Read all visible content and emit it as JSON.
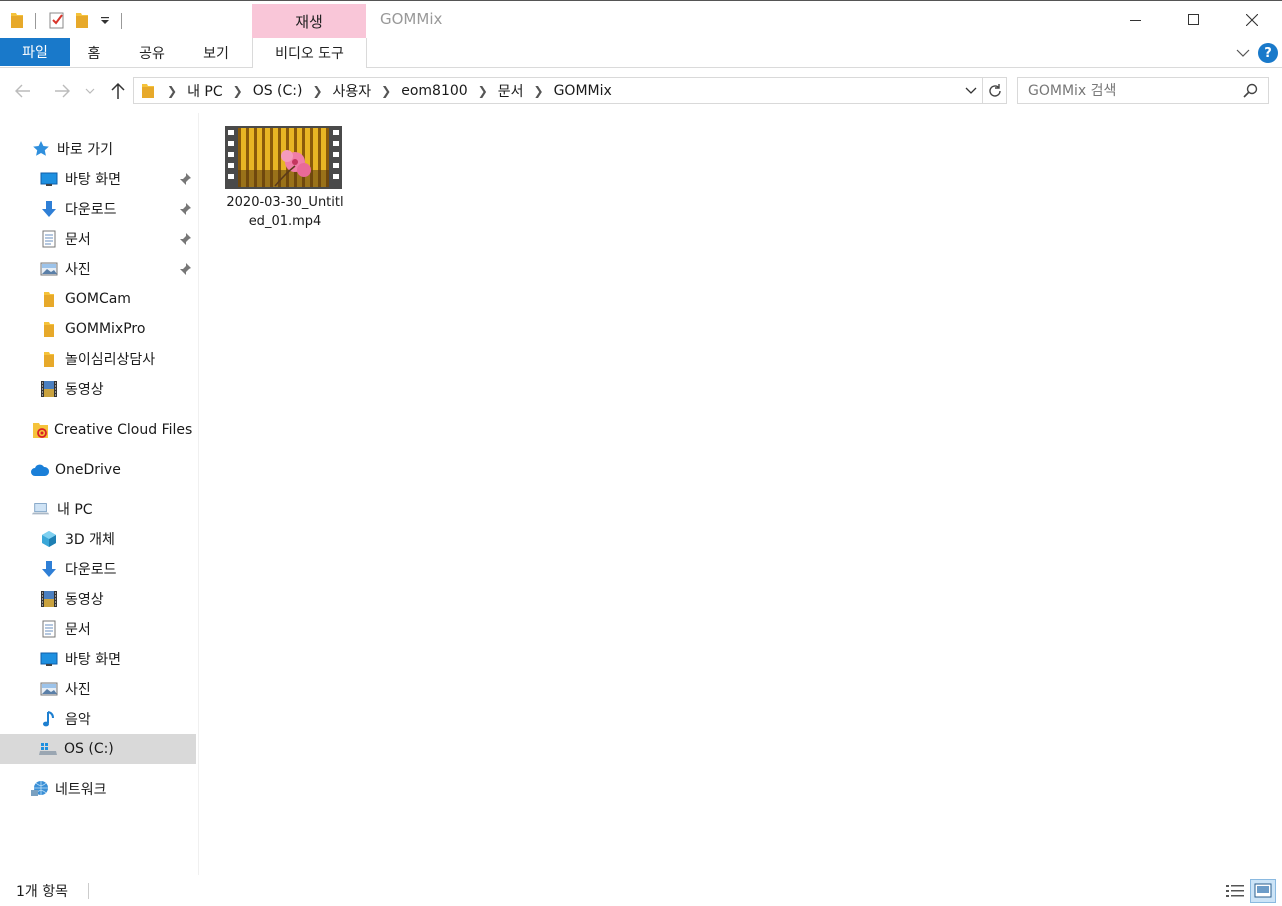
{
  "titlebar": {
    "contextual_tab": "재생",
    "window_title": "GOMMix",
    "minimize": "—",
    "maximize": "☐",
    "close": "✕"
  },
  "ribbon": {
    "tabs": [
      "파일",
      "홈",
      "공유",
      "보기",
      "비디오 도구"
    ],
    "help": "?"
  },
  "nav": {
    "breadcrumbs": [
      "내 PC",
      "OS (C:)",
      "사용자",
      "eom8100",
      "문서",
      "GOMMix"
    ],
    "search_placeholder": "GOMMix 검색"
  },
  "sidebar": {
    "quick_access": {
      "label": "바로 가기",
      "items": [
        {
          "label": "바탕 화면",
          "icon": "desktop-icon",
          "pinned": true
        },
        {
          "label": "다운로드",
          "icon": "download-icon",
          "pinned": true
        },
        {
          "label": "문서",
          "icon": "document-icon",
          "pinned": true
        },
        {
          "label": "사진",
          "icon": "pictures-icon",
          "pinned": true
        },
        {
          "label": "GOMCam",
          "icon": "folder-icon",
          "pinned": false
        },
        {
          "label": "GOMMixPro",
          "icon": "folder-icon",
          "pinned": false
        },
        {
          "label": "놀이심리상담사",
          "icon": "folder-icon",
          "pinned": false
        },
        {
          "label": "동영상",
          "icon": "video-icon",
          "pinned": false
        }
      ]
    },
    "creative_cloud": "Creative Cloud Files",
    "onedrive": "OneDrive",
    "this_pc": {
      "label": "내 PC",
      "items": [
        {
          "label": "3D 개체",
          "icon": "3d-objects-icon"
        },
        {
          "label": "다운로드",
          "icon": "download-icon"
        },
        {
          "label": "동영상",
          "icon": "video-icon"
        },
        {
          "label": "문서",
          "icon": "document-icon"
        },
        {
          "label": "바탕 화면",
          "icon": "desktop-icon"
        },
        {
          "label": "사진",
          "icon": "pictures-icon"
        },
        {
          "label": "음악",
          "icon": "music-icon"
        },
        {
          "label": "OS (C:)",
          "icon": "drive-icon",
          "selected": true
        }
      ]
    },
    "network": "네트워크"
  },
  "files": [
    {
      "name": "2020-03-30_Untitled_01.mp4",
      "type": "video-thumbnail"
    }
  ],
  "status": {
    "item_count": "1개 항목"
  },
  "colors": {
    "accent": "#1979ca",
    "contextual_tab": "#f9c6d8",
    "selected_nav": "#d9d9d9",
    "folder": "#f5c33b"
  }
}
